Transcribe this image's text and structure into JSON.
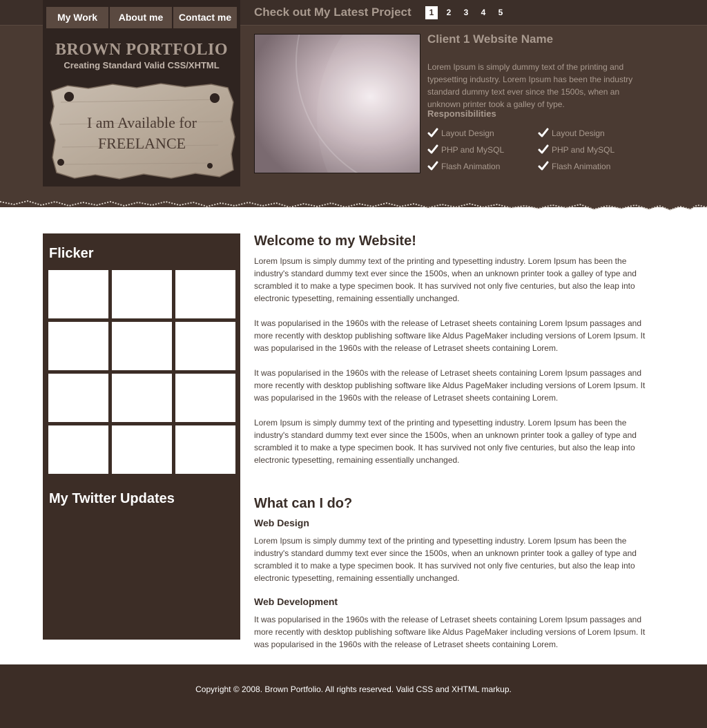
{
  "nav": {
    "items": [
      {
        "label": "My Work"
      },
      {
        "label": "About me"
      },
      {
        "label": "Contact me"
      }
    ]
  },
  "brand": {
    "title": "BROWN PORTFOLIO",
    "tagline": "Creating Standard Valid CSS/XHTML",
    "freelance_line1": "I am Available for",
    "freelance_line2": "FREELANCE"
  },
  "project": {
    "heading": "Check out My Latest Project",
    "pages": [
      "1",
      "2",
      "3",
      "4",
      "5"
    ],
    "active_page": "1",
    "client_name": "Client 1 Website Name",
    "description": "Lorem Ipsum is simply dummy text of the printing and typesetting industry. Lorem Ipsum has been the industry standard dummy text ever since the 1500s, when an unknown printer took a galley of type.",
    "responsibilities_heading": "Responsibilities",
    "responsibilities_col1": [
      "Layout Design",
      "PHP and MySQL",
      "Flash Animation"
    ],
    "responsibilities_col2": [
      "Layout Design",
      "PHP and MySQL",
      "Flash Animation"
    ]
  },
  "sidebar": {
    "flickr_title": "Flicker",
    "twitter_title": "My Twitter Updates"
  },
  "main": {
    "welcome_title": "Welcome to my Website!",
    "paragraphs": [
      "Lorem Ipsum is simply dummy text of the printing and typesetting industry. Lorem Ipsum has been the industry's standard dummy text ever since the 1500s, when an unknown printer took a galley of type and scrambled it to make a type specimen book. It has survived not only five centuries, but also the leap into electronic typesetting, remaining essentially unchanged.",
      "It was popularised in the 1960s with the release of Letraset sheets containing Lorem Ipsum passages and more recently with desktop publishing software like Aldus PageMaker including versions of Lorem Ipsum. It was popularised in the 1960s with the release of Letraset sheets containing Lorem.",
      "It was popularised in the 1960s with the release of Letraset sheets containing Lorem Ipsum passages and more recently with desktop publishing software like Aldus PageMaker including versions of Lorem Ipsum. It was popularised in the 1960s with the release of Letraset sheets containing Lorem.",
      "Lorem Ipsum is simply dummy text of the printing and typesetting industry. Lorem Ipsum has been the industry's standard dummy text ever since the 1500s, when an unknown printer took a galley of type and scrambled it to make a type specimen book. It has survived not only five centuries, but also the leap into electronic typesetting, remaining essentially unchanged."
    ],
    "services_title": "What can I do?",
    "web_design_title": "Web Design",
    "web_design_text": "Lorem Ipsum is simply dummy text of the printing and typesetting industry. Lorem Ipsum has been the industry's standard dummy text ever since the 1500s, when an unknown printer took a galley of type and scrambled it to make a type specimen book. It has survived not only five centuries, but also the leap into electronic typesetting, remaining essentially unchanged.",
    "web_dev_title": "Web Development",
    "web_dev_text": "It was popularised in the 1960s with the release of Letraset sheets containing Lorem Ipsum passages and more recently with desktop publishing software like Aldus PageMaker including versions of Lorem Ipsum. It was popularised in the 1960s with the release of Letraset sheets containing Lorem."
  },
  "footer": {
    "text": "Copyright © 2008. Brown Portfolio. All rights reserved. Valid CSS and XHTML markup."
  },
  "colors": {
    "header_bg": "#4a3a32",
    "panel_dark": "#2f2420",
    "sidebar_bg": "#3c2d26",
    "muted_text": "#a99a8f"
  },
  "icons": {
    "check": "check-icon",
    "freelance_board": "torn-paper-board"
  }
}
